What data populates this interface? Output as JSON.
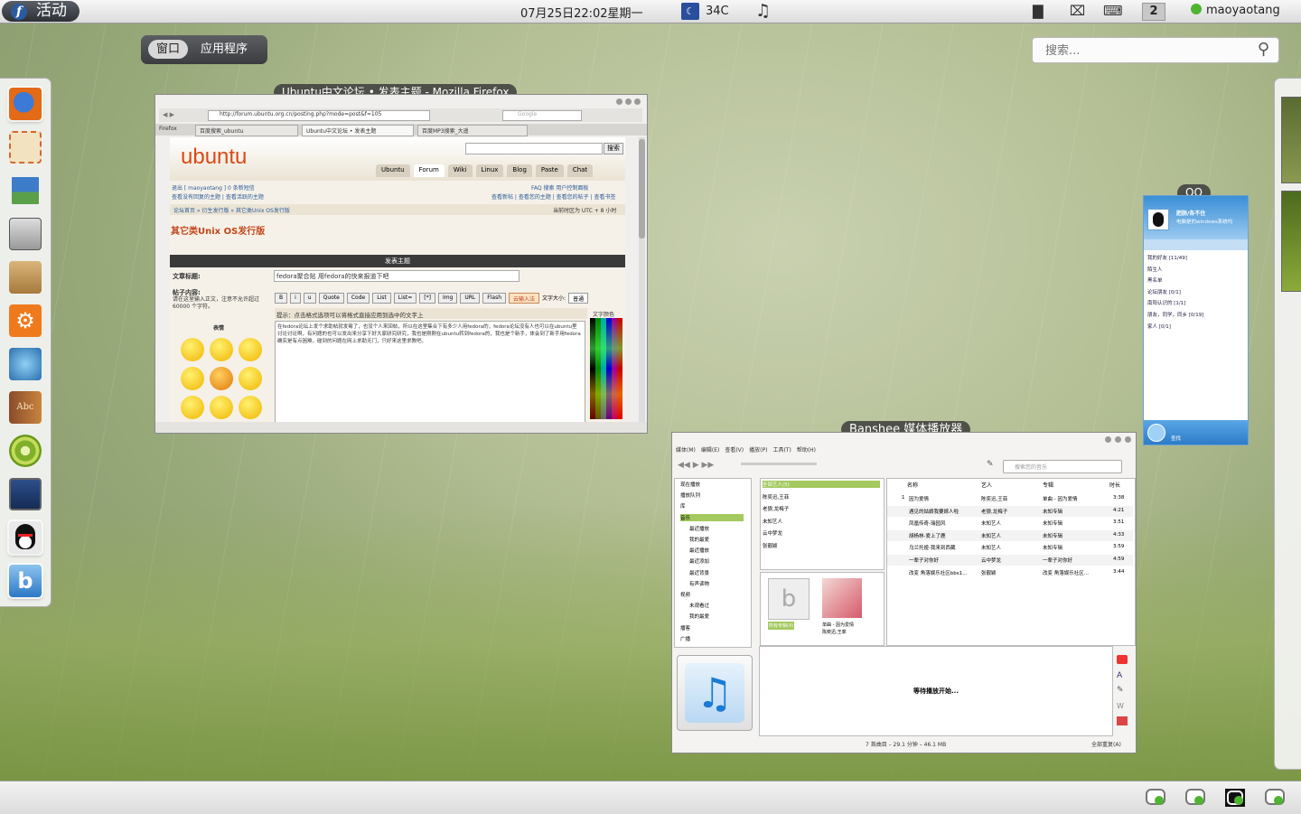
{
  "top_panel": {
    "activities_label": "活动",
    "clock": "07月25日22:02星期一",
    "weather_temp": "34C",
    "workspace_number": "2",
    "username": "maoyaotang"
  },
  "overview": {
    "tabs": [
      "窗口",
      "应用程序"
    ],
    "active_tab": "窗口",
    "search_placeholder": "搜索..."
  },
  "dash": {
    "items": [
      {
        "name": "firefox",
        "running": true
      },
      {
        "name": "mail",
        "running": false
      },
      {
        "name": "image-viewer",
        "running": false
      },
      {
        "name": "disk",
        "running": false
      },
      {
        "name": "software-installer",
        "running": false
      },
      {
        "name": "settings",
        "running": false
      },
      {
        "name": "swirl-app",
        "running": false
      },
      {
        "name": "dictionary",
        "running": false
      },
      {
        "name": "green-app",
        "running": false
      },
      {
        "name": "video",
        "running": false
      },
      {
        "name": "qq",
        "running": true
      },
      {
        "name": "banshee",
        "running": true
      }
    ]
  },
  "windows": {
    "firefox": {
      "title": "Ubuntu中文论坛 • 发表主题 - Mozilla Firefox",
      "url": "http://forum.ubuntu.org.cn/posting.php?mode=post&f=105",
      "search_engine_placeholder": "Google",
      "tabs": [
        "百度搜索_ubuntu",
        "Ubuntu中文论坛 • 发表主题",
        "百度MP3搜索_大遥"
      ],
      "menu_label": "Firefox",
      "logo": "ubuntu",
      "site_search_button": "搜索",
      "site_tabs": [
        "Ubuntu",
        "Forum",
        "Wiki",
        "Linux",
        "Blog",
        "Paste",
        "Chat"
      ],
      "user_links": "退出 [ maoyaotang ]  0 条新短信",
      "user_links2": "查看没有回复的主题 | 查看活跃的主题",
      "right_links": "FAQ  搜索  用户控制面板",
      "right_links2": "查看新帖 | 查看您的主题 | 查看您的帖子 | 查看书签",
      "breadcrumb": "论坛首页 » 衍生发行版 » 其它类Unix OS发行版",
      "timezone": "当前时区为 UTC + 8 小时",
      "forum_heading": "其它类Unix OS发行版",
      "post_header": "发表主题",
      "subject_label": "文章标题:",
      "subject_value": "fedora聚合贴 用fedora的快来报道下吧",
      "body_label": "帖子内容:",
      "body_hint": "请在这里输入正文，注意不允许超过 60000 个字符。",
      "smilies_label": "表情",
      "editor_buttons": [
        "B",
        "i",
        "u",
        "Quote",
        "Code",
        "List",
        "List=",
        "[*]",
        "Img",
        "URL",
        "Flash",
        "云输入法"
      ],
      "font_size_label": "文字大小:",
      "font_size_value": "普通",
      "color_label": "文字颜色",
      "tip": "提示：点击格式选项可以将格式直接应用到选中的文字上",
      "body_text": "在fedora论坛上发个求助帖就发霉了，也没个人来回帖，所以在这里集合下有多少人用fedora的，fedora论坛没有人也可以在ubuntu里讨论讨论啊，有问题的也可以发出来分享下好大家研究研究，我也是刚刚在ubuntu转到fedora的，我也是个新手，体会到了新手用fedora确实是有点困难，碰到的问题在网上求助无门，只好来这里求教吧。"
    },
    "banshee": {
      "title": "Banshee 媒体播放器",
      "menu": [
        "媒体(M)",
        "编辑(E)",
        "查看(V)",
        "播放(P)",
        "工具(T)",
        "帮助(H)"
      ],
      "search_placeholder": "搜索您的音乐",
      "sources": [
        "现在播放",
        "播放队列",
        "库",
        "音乐",
        "最近播放",
        "我的最爱",
        "最近播放",
        "最近添加",
        "最近背景",
        "有声读物",
        "视频",
        "未观看过",
        "我的最爱",
        "播客",
        "广播"
      ],
      "artists": [
        "全部艺人(5)",
        "陈奕迅,王菲",
        "老狼,龙梅子",
        "未知艺人",
        "云中梦龙",
        "张靓颖"
      ],
      "albums": [
        {
          "title": "所有专辑(4)"
        },
        {
          "title": "单曲 - 因为爱情",
          "artist": "陈奕迅,王菲"
        }
      ],
      "columns": [
        "名称",
        "艺人",
        "专辑",
        "时长"
      ],
      "tracks": [
        {
          "num": "1",
          "name": "因为爱情",
          "artist": "陈奕迅,王菲",
          "album": "单曲 - 因为爱情",
          "duration": "3:38"
        },
        {
          "num": "",
          "name": "遇见的姑娘我要嫁人啦",
          "artist": "老狼,龙梅子",
          "album": "未知专辑",
          "duration": "4:21"
        },
        {
          "num": "",
          "name": "凤凰传奇-瑞园风",
          "artist": "未知艺人",
          "album": "未知专辑",
          "duration": "3:51"
        },
        {
          "num": "",
          "name": "胡杨林-爱上了鹿",
          "artist": "未知艺人",
          "album": "未知专辑",
          "duration": "4:33"
        },
        {
          "num": "",
          "name": "乌兰托娅-我来到西藏",
          "artist": "未知艺人",
          "album": "未知专辑",
          "duration": "3:59"
        },
        {
          "num": "",
          "name": "一辈子对你好",
          "artist": "云中梦龙",
          "album": "一辈子对你好",
          "duration": "4:59"
        },
        {
          "num": "",
          "name": "改变 角落娱乐社区bbs1...",
          "artist": "张靓颖",
          "album": "改变 角落娱乐社区...",
          "duration": "3:44"
        }
      ],
      "now_playing": "等待播放开始...",
      "status": "7 首曲目 – 29.1 分钟 – 46.1 MB",
      "repeat": "全部重复(A)"
    },
    "qq": {
      "title": "QQ",
      "nickname": "肥肠/各不住",
      "status_msg": "电脑是的windows系统吗",
      "groups": [
        "我的好友 [11/49]",
        "陌生人",
        "黑名单",
        "论坛朋友 [0/1]",
        "南阳认识的 [1/1]",
        "朋友，同学，同乡 [0/19]",
        "家人 [0/1]"
      ],
      "find_label": "查找"
    }
  },
  "colors": {
    "banshee_selection": "#a3c95f",
    "ubuntu_orange": "#dd4814",
    "qq_blue": "#3a8fd6"
  }
}
